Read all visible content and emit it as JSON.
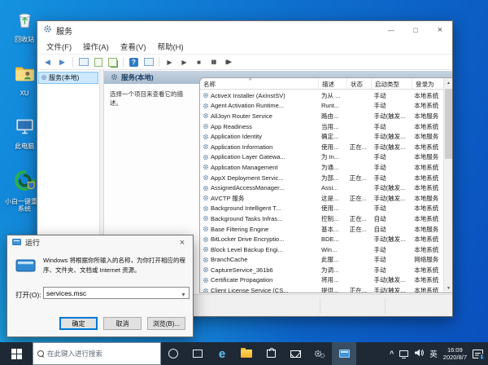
{
  "colors": {
    "accent": "#0078d7",
    "desktop_top": "#1492df",
    "desktop_bottom": "#0a4fbd",
    "taskbar": "#1f2935",
    "selection": "#cbe8ff"
  },
  "desktop": {
    "icons": [
      {
        "label": "回收站",
        "icon": "recycle-bin-icon"
      },
      {
        "label": "XU",
        "icon": "user-folder-icon"
      },
      {
        "label": "此电脑",
        "icon": "this-pc-icon"
      },
      {
        "label": "小白一键重装系统",
        "icon": "reinstall-tool-icon"
      }
    ]
  },
  "services_window": {
    "title": "服务",
    "menus": [
      "文件(F)",
      "操作(A)",
      "查看(V)",
      "帮助(H)"
    ],
    "tree_root": "服务(本地)",
    "main_header": "服务(本地)",
    "hint": "选择一个项目来查看它的描述。",
    "columns": [
      "名称",
      "描述",
      "状态",
      "启动类型",
      "登录为"
    ],
    "rows": [
      {
        "name": "ActiveX Installer (AxInstSV)",
        "desc": "为从 ...",
        "status": "",
        "startup": "手动",
        "logon": "本地系统"
      },
      {
        "name": "Agent Activation Runtime...",
        "desc": "Runt...",
        "status": "",
        "startup": "手动",
        "logon": "本地系统"
      },
      {
        "name": "AllJoyn Router Service",
        "desc": "路由...",
        "status": "",
        "startup": "手动(触发...",
        "logon": "本地服务"
      },
      {
        "name": "App Readiness",
        "desc": "当用...",
        "status": "",
        "startup": "手动",
        "logon": "本地系统"
      },
      {
        "name": "Application Identity",
        "desc": "确定...",
        "status": "",
        "startup": "手动(触发...",
        "logon": "本地服务"
      },
      {
        "name": "Application Information",
        "desc": "使用...",
        "status": "正在...",
        "startup": "手动(触发...",
        "logon": "本地系统"
      },
      {
        "name": "Application Layer Gatewa...",
        "desc": "为 In...",
        "status": "",
        "startup": "手动",
        "logon": "本地服务"
      },
      {
        "name": "Application Management",
        "desc": "为通...",
        "status": "",
        "startup": "手动",
        "logon": "本地系统"
      },
      {
        "name": "AppX Deployment Servic...",
        "desc": "为部...",
        "status": "正在...",
        "startup": "手动",
        "logon": "本地系统"
      },
      {
        "name": "AssignedAccessManager...",
        "desc": "Assi...",
        "status": "",
        "startup": "手动(触发...",
        "logon": "本地系统"
      },
      {
        "name": "AVCTP 服务",
        "desc": "这是...",
        "status": "正在...",
        "startup": "手动(触发...",
        "logon": "本地服务"
      },
      {
        "name": "Background Intelligent T...",
        "desc": "使用...",
        "status": "",
        "startup": "手动",
        "logon": "本地系统"
      },
      {
        "name": "Background Tasks Infras...",
        "desc": "控制...",
        "status": "正在...",
        "startup": "自动",
        "logon": "本地系统"
      },
      {
        "name": "Base Filtering Engine",
        "desc": "基本...",
        "status": "正在...",
        "startup": "自动",
        "logon": "本地服务"
      },
      {
        "name": "BitLocker Drive Encryptio...",
        "desc": "BDE...",
        "status": "",
        "startup": "手动(触发...",
        "logon": "本地系统"
      },
      {
        "name": "Block Level Backup Engi...",
        "desc": "Win...",
        "status": "",
        "startup": "手动",
        "logon": "本地系统"
      },
      {
        "name": "BranchCache",
        "desc": "此服...",
        "status": "",
        "startup": "手动",
        "logon": "网络服务"
      },
      {
        "name": "CaptureService_361b6",
        "desc": "为调...",
        "status": "",
        "startup": "手动",
        "logon": "本地系统"
      },
      {
        "name": "Certificate Propagation",
        "desc": "将用...",
        "status": "",
        "startup": "手动(触发...",
        "logon": "本地系统"
      },
      {
        "name": "Client License Service (CS...",
        "desc": "提供...",
        "status": "正在...",
        "startup": "手动(触发...",
        "logon": "本地系统"
      }
    ]
  },
  "run_dialog": {
    "title": "运行",
    "message": "Windows 将根据你所输入的名称，为你打开相应的程序、文件夹、文档或 Internet 资源。",
    "open_label": "打开(O):",
    "open_value": "services.msc",
    "buttons": {
      "ok": "确定",
      "cancel": "取消",
      "browse": "浏览(B)..."
    }
  },
  "taskbar": {
    "search_placeholder": "在此键入进行搜索",
    "edge_letter": "e",
    "ime": "英",
    "time": "16:09",
    "date": "2020/8/7",
    "badge": "1"
  }
}
